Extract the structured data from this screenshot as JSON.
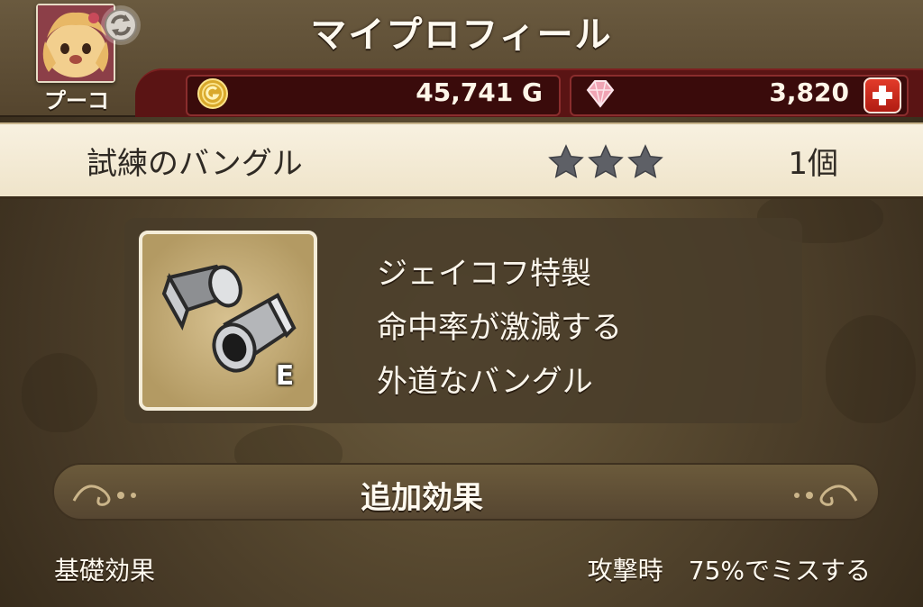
{
  "header": {
    "title": "マイプロフィール",
    "player_name": "プーコ"
  },
  "currency": {
    "gold": "45,741 G",
    "gems": "3,820",
    "gold_icon": "gold-coin-icon",
    "gem_icon": "gem-icon",
    "add_icon": "plus-icon"
  },
  "item": {
    "name": "試練のバングル",
    "stars": 3,
    "count": "1個",
    "grade": "E",
    "description": [
      "ジェイコフ特製",
      "命中率が激減する",
      "外道なバングル"
    ]
  },
  "effects": {
    "section_title": "追加効果",
    "base_label": "基礎効果",
    "base_value": "攻撃時　75%でミスする"
  },
  "colors": {
    "top_bar": "#55452e",
    "currency_band": "#5a1414",
    "item_header": "#f4ebd6",
    "panel": "#483c2a",
    "add_button": "#d22f20"
  }
}
